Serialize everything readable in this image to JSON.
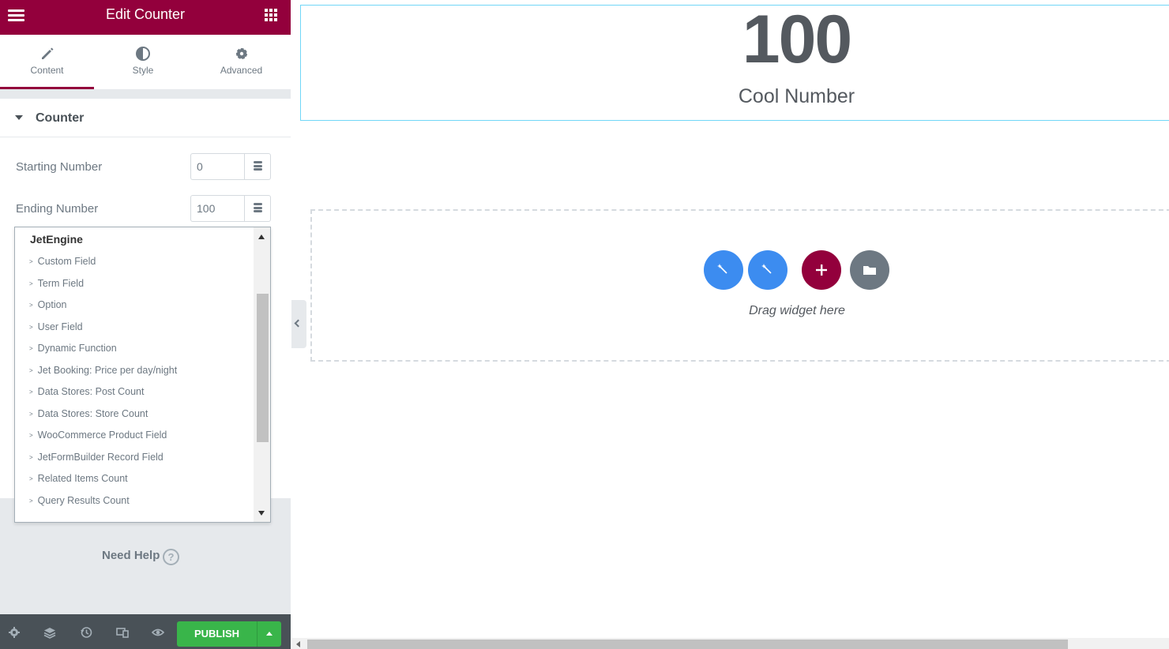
{
  "header": {
    "title": "Edit Counter"
  },
  "tabs": [
    {
      "label": "Content",
      "icon": "pencil-icon",
      "active": true
    },
    {
      "label": "Style",
      "icon": "contrast-icon",
      "active": false
    },
    {
      "label": "Advanced",
      "icon": "gear-icon",
      "active": false
    }
  ],
  "section": {
    "title": "Counter"
  },
  "controls": {
    "starting": {
      "label": "Starting Number",
      "value": "0"
    },
    "ending": {
      "label": "Ending Number",
      "value": "100"
    }
  },
  "dropdown": {
    "group": "JetEngine",
    "items": [
      "Custom Field",
      "Term Field",
      "Option",
      "User Field",
      "Dynamic Function",
      "Jet Booking: Price per day/night",
      "Data Stores: Post Count",
      "Data Stores: Store Count",
      "WooCommerce Product Field",
      "JetFormBuilder Record Field",
      "Related Items Count",
      "Query Results Count"
    ]
  },
  "help": {
    "label": "Need Help",
    "icon": "?"
  },
  "footer": {
    "publish_label": "PUBLISH"
  },
  "preview": {
    "counter_number": "100",
    "counter_title": "Cool Number",
    "drag_text": "Drag widget here"
  },
  "colors": {
    "brand": "#93003c",
    "publish": "#39b54a",
    "magic": "#3c8cf0",
    "neutral": "#6d7882"
  }
}
